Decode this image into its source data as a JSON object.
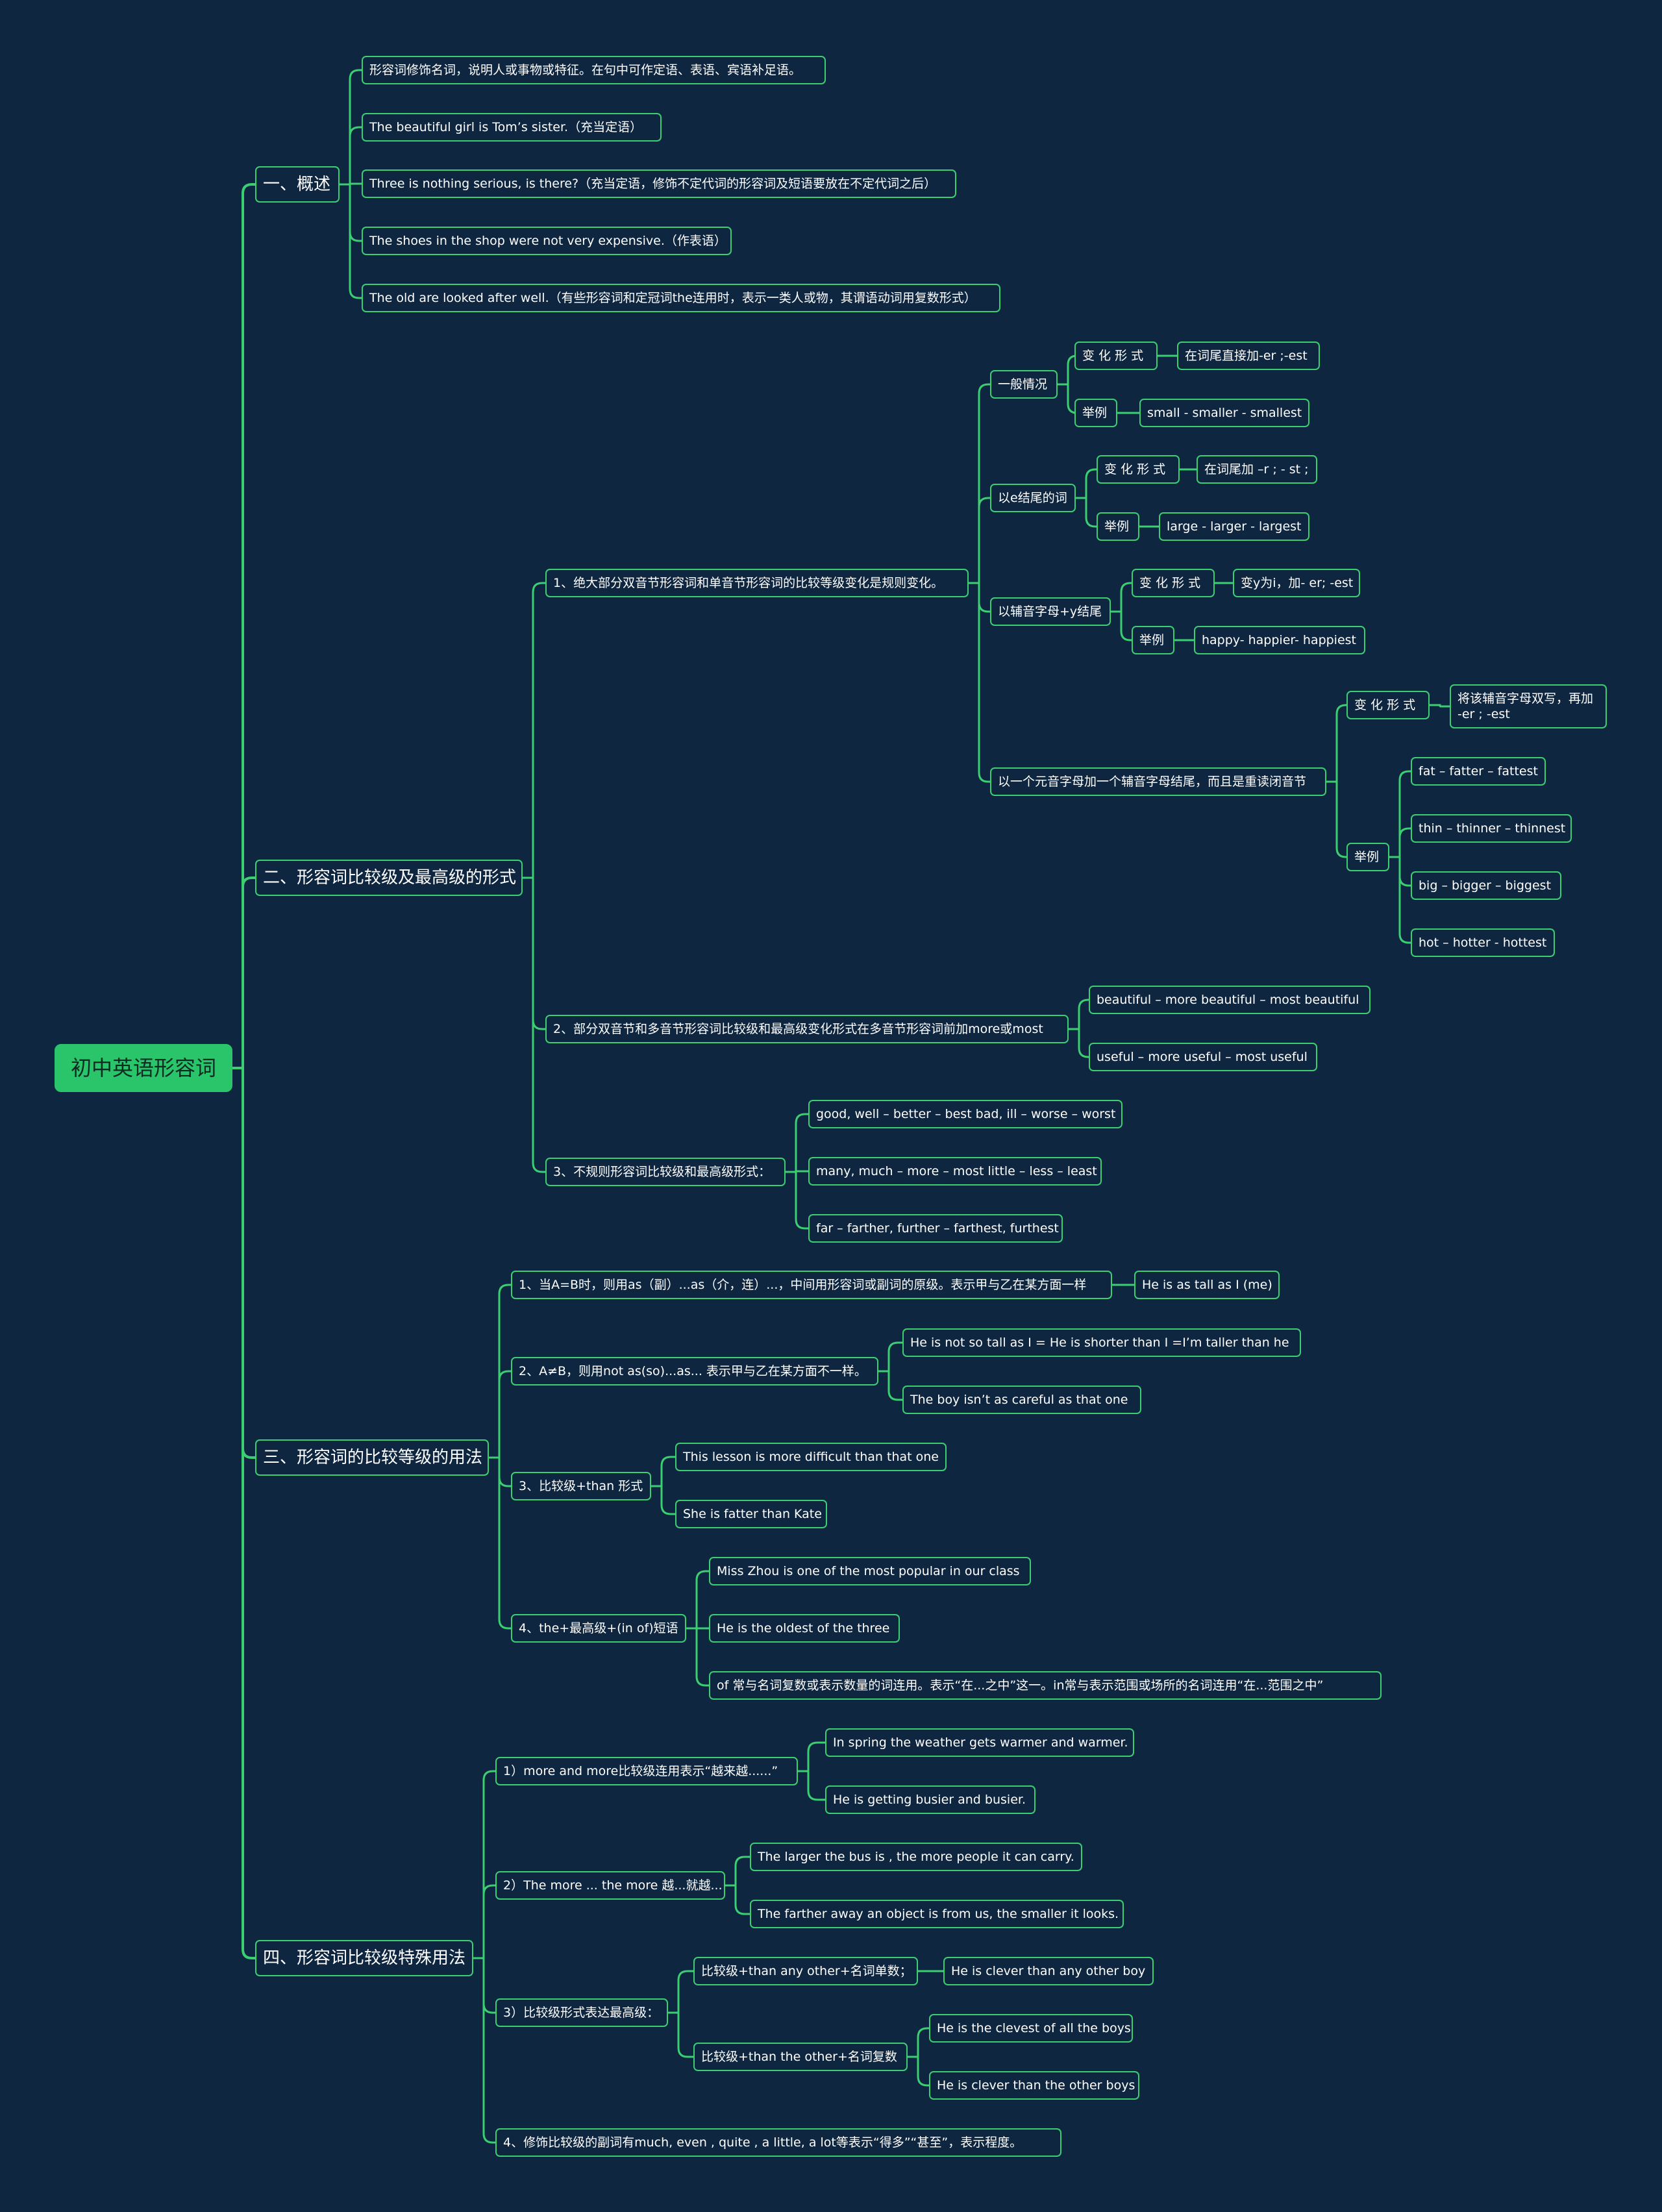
{
  "colors": {
    "background": "#0e2640",
    "line": "#3ccf72",
    "root_fill": "#2ac46a",
    "text": "#ffffff"
  },
  "nodes": [
    {
      "id": "root",
      "text": "初中英语形容词"
    },
    {
      "id": "s1",
      "parent": "root",
      "text": "一、概述"
    },
    {
      "id": "s1a",
      "parent": "s1",
      "text": "形容词修饰名词，说明人或事物或特征。在句中可作定语、表语、宾语补足语。"
    },
    {
      "id": "s1b",
      "parent": "s1",
      "text": "The beautiful girl is Tom’s sister.（充当定语）"
    },
    {
      "id": "s1c",
      "parent": "s1",
      "text": "Three is nothing serious, is there?（充当定语，修饰不定代词的形容词及短语要放在不定代词之后）"
    },
    {
      "id": "s1d",
      "parent": "s1",
      "text": "The shoes in the shop were not very expensive.（作表语）"
    },
    {
      "id": "s1e",
      "parent": "s1",
      "text": "The old are looked after well.（有些形容词和定冠词the连用时，表示一类人或物，其谓语动词用复数形式）"
    },
    {
      "id": "s2",
      "parent": "root",
      "text": "二、形容词比较级及最高级的形式"
    },
    {
      "id": "s2_1",
      "parent": "s2",
      "text": "1、绝大部分双音节形容词和单音节形容词的比较等级变化是规则变化。"
    },
    {
      "id": "g1",
      "parent": "s2_1",
      "text": "一般情况"
    },
    {
      "id": "g1a",
      "parent": "g1",
      "text": "变 化 形 式"
    },
    {
      "id": "g1a1",
      "parent": "g1a",
      "text": "在词尾直接加-er ;-est"
    },
    {
      "id": "g1b",
      "parent": "g1",
      "text": "举例"
    },
    {
      "id": "g1b1",
      "parent": "g1b",
      "text": "small - smaller - smallest"
    },
    {
      "id": "g2",
      "parent": "s2_1",
      "text": "以e结尾的词"
    },
    {
      "id": "g2a",
      "parent": "g2",
      "text": "变 化 形 式"
    },
    {
      "id": "g2a1",
      "parent": "g2a",
      "text": "在词尾加 –r ; - st ;"
    },
    {
      "id": "g2b",
      "parent": "g2",
      "text": "举例"
    },
    {
      "id": "g2b1",
      "parent": "g2b",
      "text": "large - larger - largest"
    },
    {
      "id": "g3",
      "parent": "s2_1",
      "text": "以辅音字母+y结尾"
    },
    {
      "id": "g3a",
      "parent": "g3",
      "text": "变 化 形 式"
    },
    {
      "id": "g3a1",
      "parent": "g3a",
      "text": "变y为i，加- er; -est"
    },
    {
      "id": "g3b",
      "parent": "g3",
      "text": "举例"
    },
    {
      "id": "g3b1",
      "parent": "g3b",
      "text": "happy- happier- happiest"
    },
    {
      "id": "g4",
      "parent": "s2_1",
      "text": "以一个元音字母加一个辅音字母结尾，而且是重读闭音节"
    },
    {
      "id": "g4a",
      "parent": "g4",
      "text": "变 化 形 式"
    },
    {
      "id": "g4a1",
      "parent": "g4a",
      "text": "将该辅音字母双写，再加 -er ; -est"
    },
    {
      "id": "g4b",
      "parent": "g4",
      "text": "举例"
    },
    {
      "id": "g4b1",
      "parent": "g4b",
      "text": "fat – fatter – fattest"
    },
    {
      "id": "g4b2",
      "parent": "g4b",
      "text": "thin – thinner – thinnest"
    },
    {
      "id": "g4b3",
      "parent": "g4b",
      "text": "big – bigger – biggest"
    },
    {
      "id": "g4b4",
      "parent": "g4b",
      "text": "hot – hotter - hottest"
    },
    {
      "id": "s2_2",
      "parent": "s2",
      "text": "2、部分双音节和多音节形容词比较级和最高级变化形式在多音节形容词前加more或most"
    },
    {
      "id": "s2_2a",
      "parent": "s2_2",
      "text": "beautiful – more beautiful – most beautiful"
    },
    {
      "id": "s2_2b",
      "parent": "s2_2",
      "text": "useful – more useful – most useful"
    },
    {
      "id": "s2_3",
      "parent": "s2",
      "text": "3、不规则形容词比较级和最高级形式："
    },
    {
      "id": "s2_3a",
      "parent": "s2_3",
      "text": "good, well – better – best bad, ill – worse – worst"
    },
    {
      "id": "s2_3b",
      "parent": "s2_3",
      "text": "many, much – more – most little – less – least"
    },
    {
      "id": "s2_3c",
      "parent": "s2_3",
      "text": "far – farther, further – farthest, furthest"
    },
    {
      "id": "s3",
      "parent": "root",
      "text": "三、形容词的比较等级的用法"
    },
    {
      "id": "s3_1",
      "parent": "s3",
      "text": "1、当A=B时，则用as（副）...as（介，连）...，中间用形容词或副词的原级。表示甲与乙在某方面一样"
    },
    {
      "id": "s3_1a",
      "parent": "s3_1",
      "text": "He is as tall as I (me)"
    },
    {
      "id": "s3_2",
      "parent": "s3",
      "text": "2、A≠B，则用not as(so)...as... 表示甲与乙在某方面不一样。"
    },
    {
      "id": "s3_2a",
      "parent": "s3_2",
      "text": "He is not so tall as I = He is shorter than I =I’m taller than he"
    },
    {
      "id": "s3_2b",
      "parent": "s3_2",
      "text": "The boy isn’t as careful as that one"
    },
    {
      "id": "s3_3",
      "parent": "s3",
      "text": "3、比较级+than 形式"
    },
    {
      "id": "s3_3a",
      "parent": "s3_3",
      "text": "This lesson is more difficult than that one"
    },
    {
      "id": "s3_3b",
      "parent": "s3_3",
      "text": "She is fatter than Kate"
    },
    {
      "id": "s3_4",
      "parent": "s3",
      "text": "4、the+最高级+(in of)短语"
    },
    {
      "id": "s3_4a",
      "parent": "s3_4",
      "text": "Miss Zhou is one of the most popular in our class"
    },
    {
      "id": "s3_4b",
      "parent": "s3_4",
      "text": "He is the oldest of the three"
    },
    {
      "id": "s3_4c",
      "parent": "s3_4",
      "text": "of 常与名词复数或表示数量的词连用。表示“在...之中”这一。in常与表示范围或场所的名词连用“在...范围之中”"
    },
    {
      "id": "s4",
      "parent": "root",
      "text": "四、形容词比较级特殊用法"
    },
    {
      "id": "s4_1",
      "parent": "s4",
      "text": "1）more and more比较级连用表示“越来越......”"
    },
    {
      "id": "s4_1a",
      "parent": "s4_1",
      "text": "In spring the weather gets warmer and warmer."
    },
    {
      "id": "s4_1b",
      "parent": "s4_1",
      "text": "He is getting busier and busier."
    },
    {
      "id": "s4_2",
      "parent": "s4",
      "text": "2）The more ... the more 越...就越..."
    },
    {
      "id": "s4_2a",
      "parent": "s4_2",
      "text": "The larger the bus is , the more people it can carry."
    },
    {
      "id": "s4_2b",
      "parent": "s4_2",
      "text": "The farther away an object is from us, the smaller it looks."
    },
    {
      "id": "s4_3",
      "parent": "s4",
      "text": "3）比较级形式表达最高级："
    },
    {
      "id": "s4_3a",
      "parent": "s4_3",
      "text": "比较级+than any other+名词单数；"
    },
    {
      "id": "s4_3a1",
      "parent": "s4_3a",
      "text": "He is clever than any other boy"
    },
    {
      "id": "s4_3b",
      "parent": "s4_3",
      "text": "比较级+than the other+名词复数"
    },
    {
      "id": "s4_3b1",
      "parent": "s4_3b",
      "text": "He is the clevest of all the boys"
    },
    {
      "id": "s4_3b2",
      "parent": "s4_3b",
      "text": "He is clever than the other boys"
    },
    {
      "id": "s4_4",
      "parent": "s4",
      "text": "4、修饰比较级的副词有much, even , quite , a little, a lot等表示“得多”“甚至”，表示程度。"
    }
  ]
}
